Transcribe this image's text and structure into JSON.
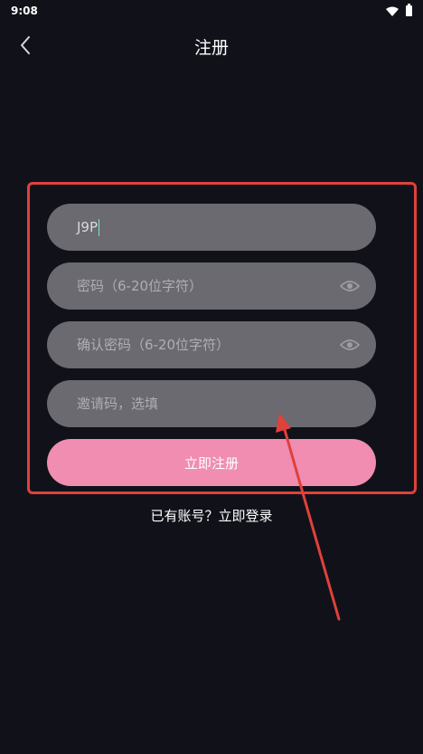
{
  "status_bar": {
    "time": "9:08"
  },
  "header": {
    "title": "注册"
  },
  "form": {
    "username_value": "J9P",
    "password_placeholder": "密码（6-20位字符）",
    "confirm_placeholder": "确认密码（6-20位字符）",
    "invite_placeholder": "邀请码，选填",
    "register_label": "立即注册"
  },
  "footer": {
    "login_prefix": "已有账号？",
    "login_link": "立即登录"
  },
  "colors": {
    "background": "#11111a",
    "field": "#6a6a70",
    "accent": "#f08db1",
    "annotation": "#e0413a"
  }
}
